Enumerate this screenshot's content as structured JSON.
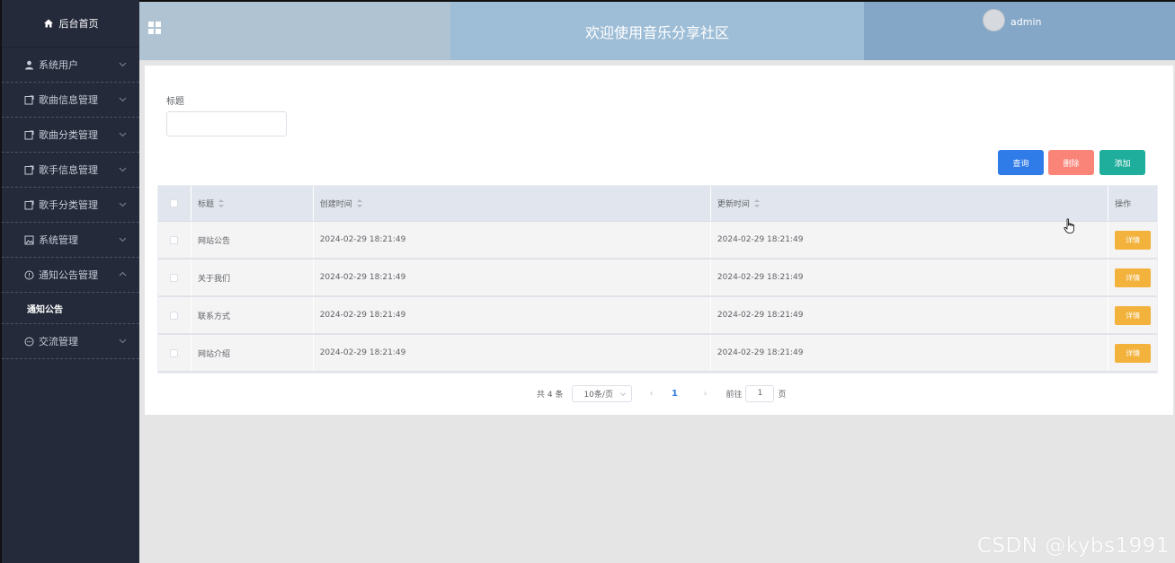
{
  "sidebar": {
    "home_label": "后台首页",
    "items": [
      {
        "label": "系统用户",
        "icon": "user-icon"
      },
      {
        "label": "歌曲信息管理",
        "icon": "note-icon"
      },
      {
        "label": "歌曲分类管理",
        "icon": "note-icon"
      },
      {
        "label": "歌手信息管理",
        "icon": "note-icon"
      },
      {
        "label": "歌手分类管理",
        "icon": "note-icon"
      },
      {
        "label": "系统管理",
        "icon": "image-icon"
      },
      {
        "label": "通知公告管理",
        "icon": "info-icon"
      },
      {
        "label": "交流管理",
        "icon": "chat-icon"
      }
    ],
    "sub_item": "通知公告"
  },
  "header": {
    "title": "欢迎使用音乐分享社区",
    "username": "admin"
  },
  "search": {
    "label": "标题",
    "value": ""
  },
  "buttons": {
    "query": "查询",
    "delete": "删除",
    "add": "添加"
  },
  "table": {
    "columns": [
      "标题",
      "创建时间",
      "更新时间",
      "操作"
    ],
    "rows": [
      {
        "title": "网站公告",
        "created": "2024-02-29 18:21:49",
        "updated": "2024-02-29 18:21:49",
        "action": "详情"
      },
      {
        "title": "关于我们",
        "created": "2024-02-29 18:21:49",
        "updated": "2024-02-29 18:21:49",
        "action": "详情"
      },
      {
        "title": "联系方式",
        "created": "2024-02-29 18:21:49",
        "updated": "2024-02-29 18:21:49",
        "action": "详情"
      },
      {
        "title": "网站介绍",
        "created": "2024-02-29 18:21:49",
        "updated": "2024-02-29 18:21:49",
        "action": "详情"
      }
    ]
  },
  "pagination": {
    "total": "共 4 条",
    "page_size": "10条/页",
    "current_page": "1",
    "goto_label": "前往",
    "goto_value": "1",
    "page_suffix": "页"
  },
  "watermark": "CSDN @kybs1991",
  "colors": {
    "sidebar_bg": "#242a3a",
    "query_btn": "#2f7be8",
    "delete_btn": "#fa8478",
    "add_btn": "#1fae9b",
    "detail_btn": "#f2b23c"
  }
}
